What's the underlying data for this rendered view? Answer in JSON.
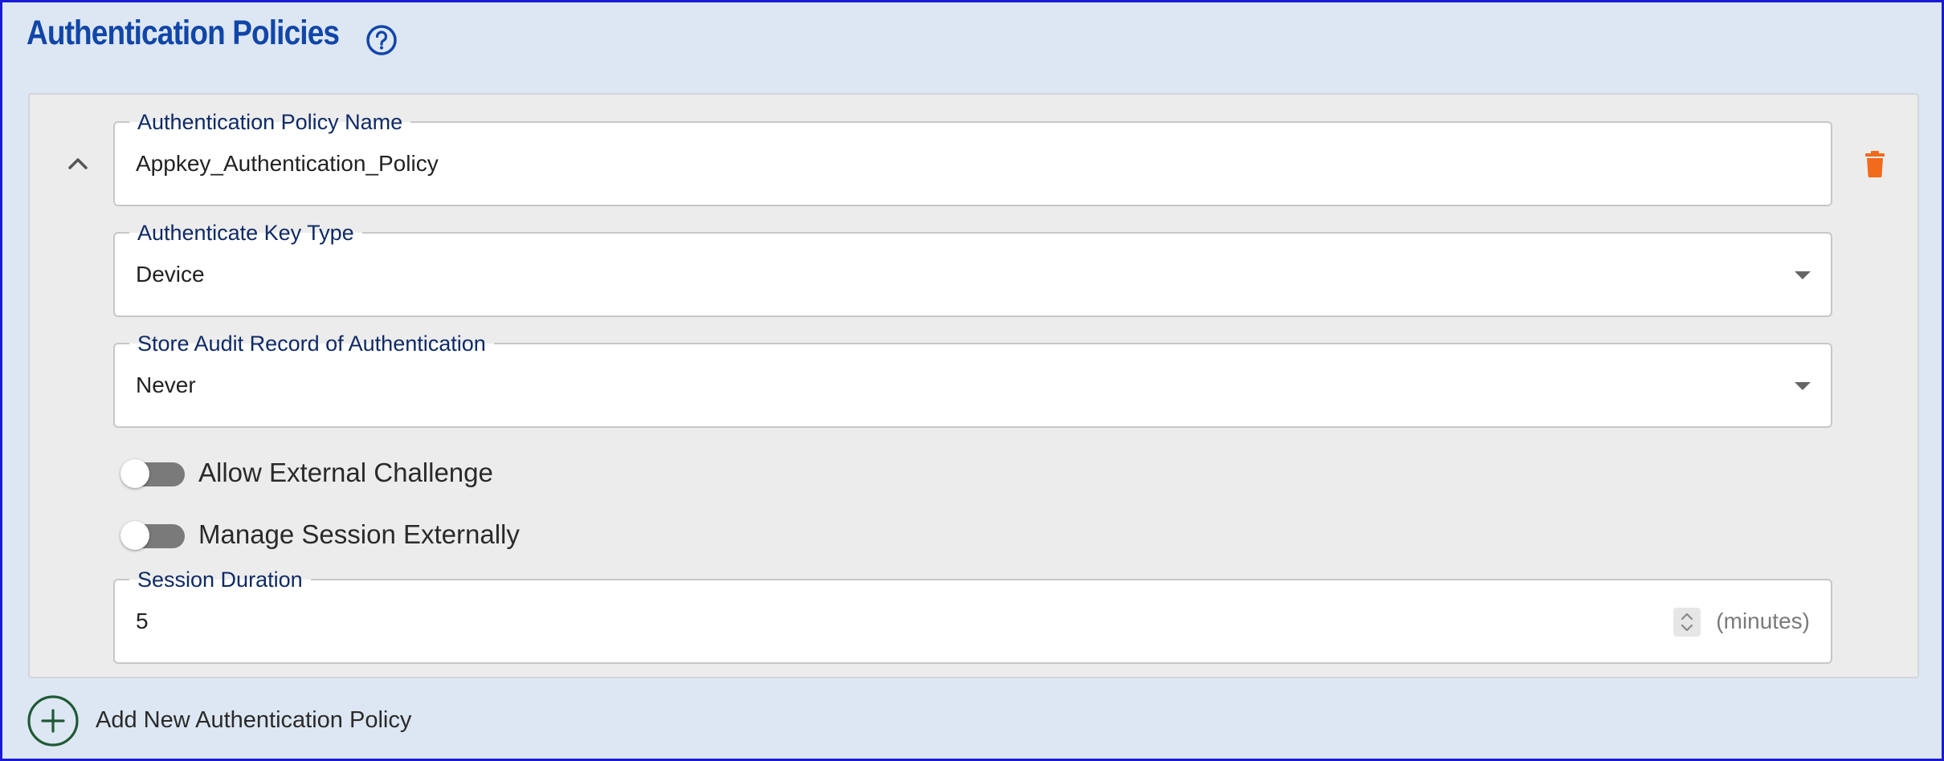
{
  "section": {
    "title": "Authentication Policies",
    "help_icon": "help-circle-icon"
  },
  "policy": {
    "collapse_icon": "chevron-up-icon",
    "delete_icon": "trash-icon",
    "name_field": {
      "label": "Authentication Policy Name",
      "value": "Appkey_Authentication_Policy"
    },
    "key_type": {
      "label": "Authenticate Key Type",
      "value": "Device"
    },
    "audit_record": {
      "label": "Store Audit Record of Authentication",
      "value": "Never"
    },
    "allow_external_challenge": {
      "label": "Allow External Challenge",
      "on": false
    },
    "manage_session_externally": {
      "label": "Manage Session Externally",
      "on": false
    },
    "session_duration": {
      "label": "Session Duration",
      "value": "5",
      "units": "(minutes)"
    }
  },
  "add_policy": {
    "label": "Add New Authentication Policy",
    "icon": "plus-circle-icon"
  },
  "colors": {
    "title": "#1146a8",
    "frame_border": "#1a1ad6",
    "delete": "#f26a1b",
    "add_icon": "#1f5a35",
    "toggle_off": "#7a7a7a"
  }
}
